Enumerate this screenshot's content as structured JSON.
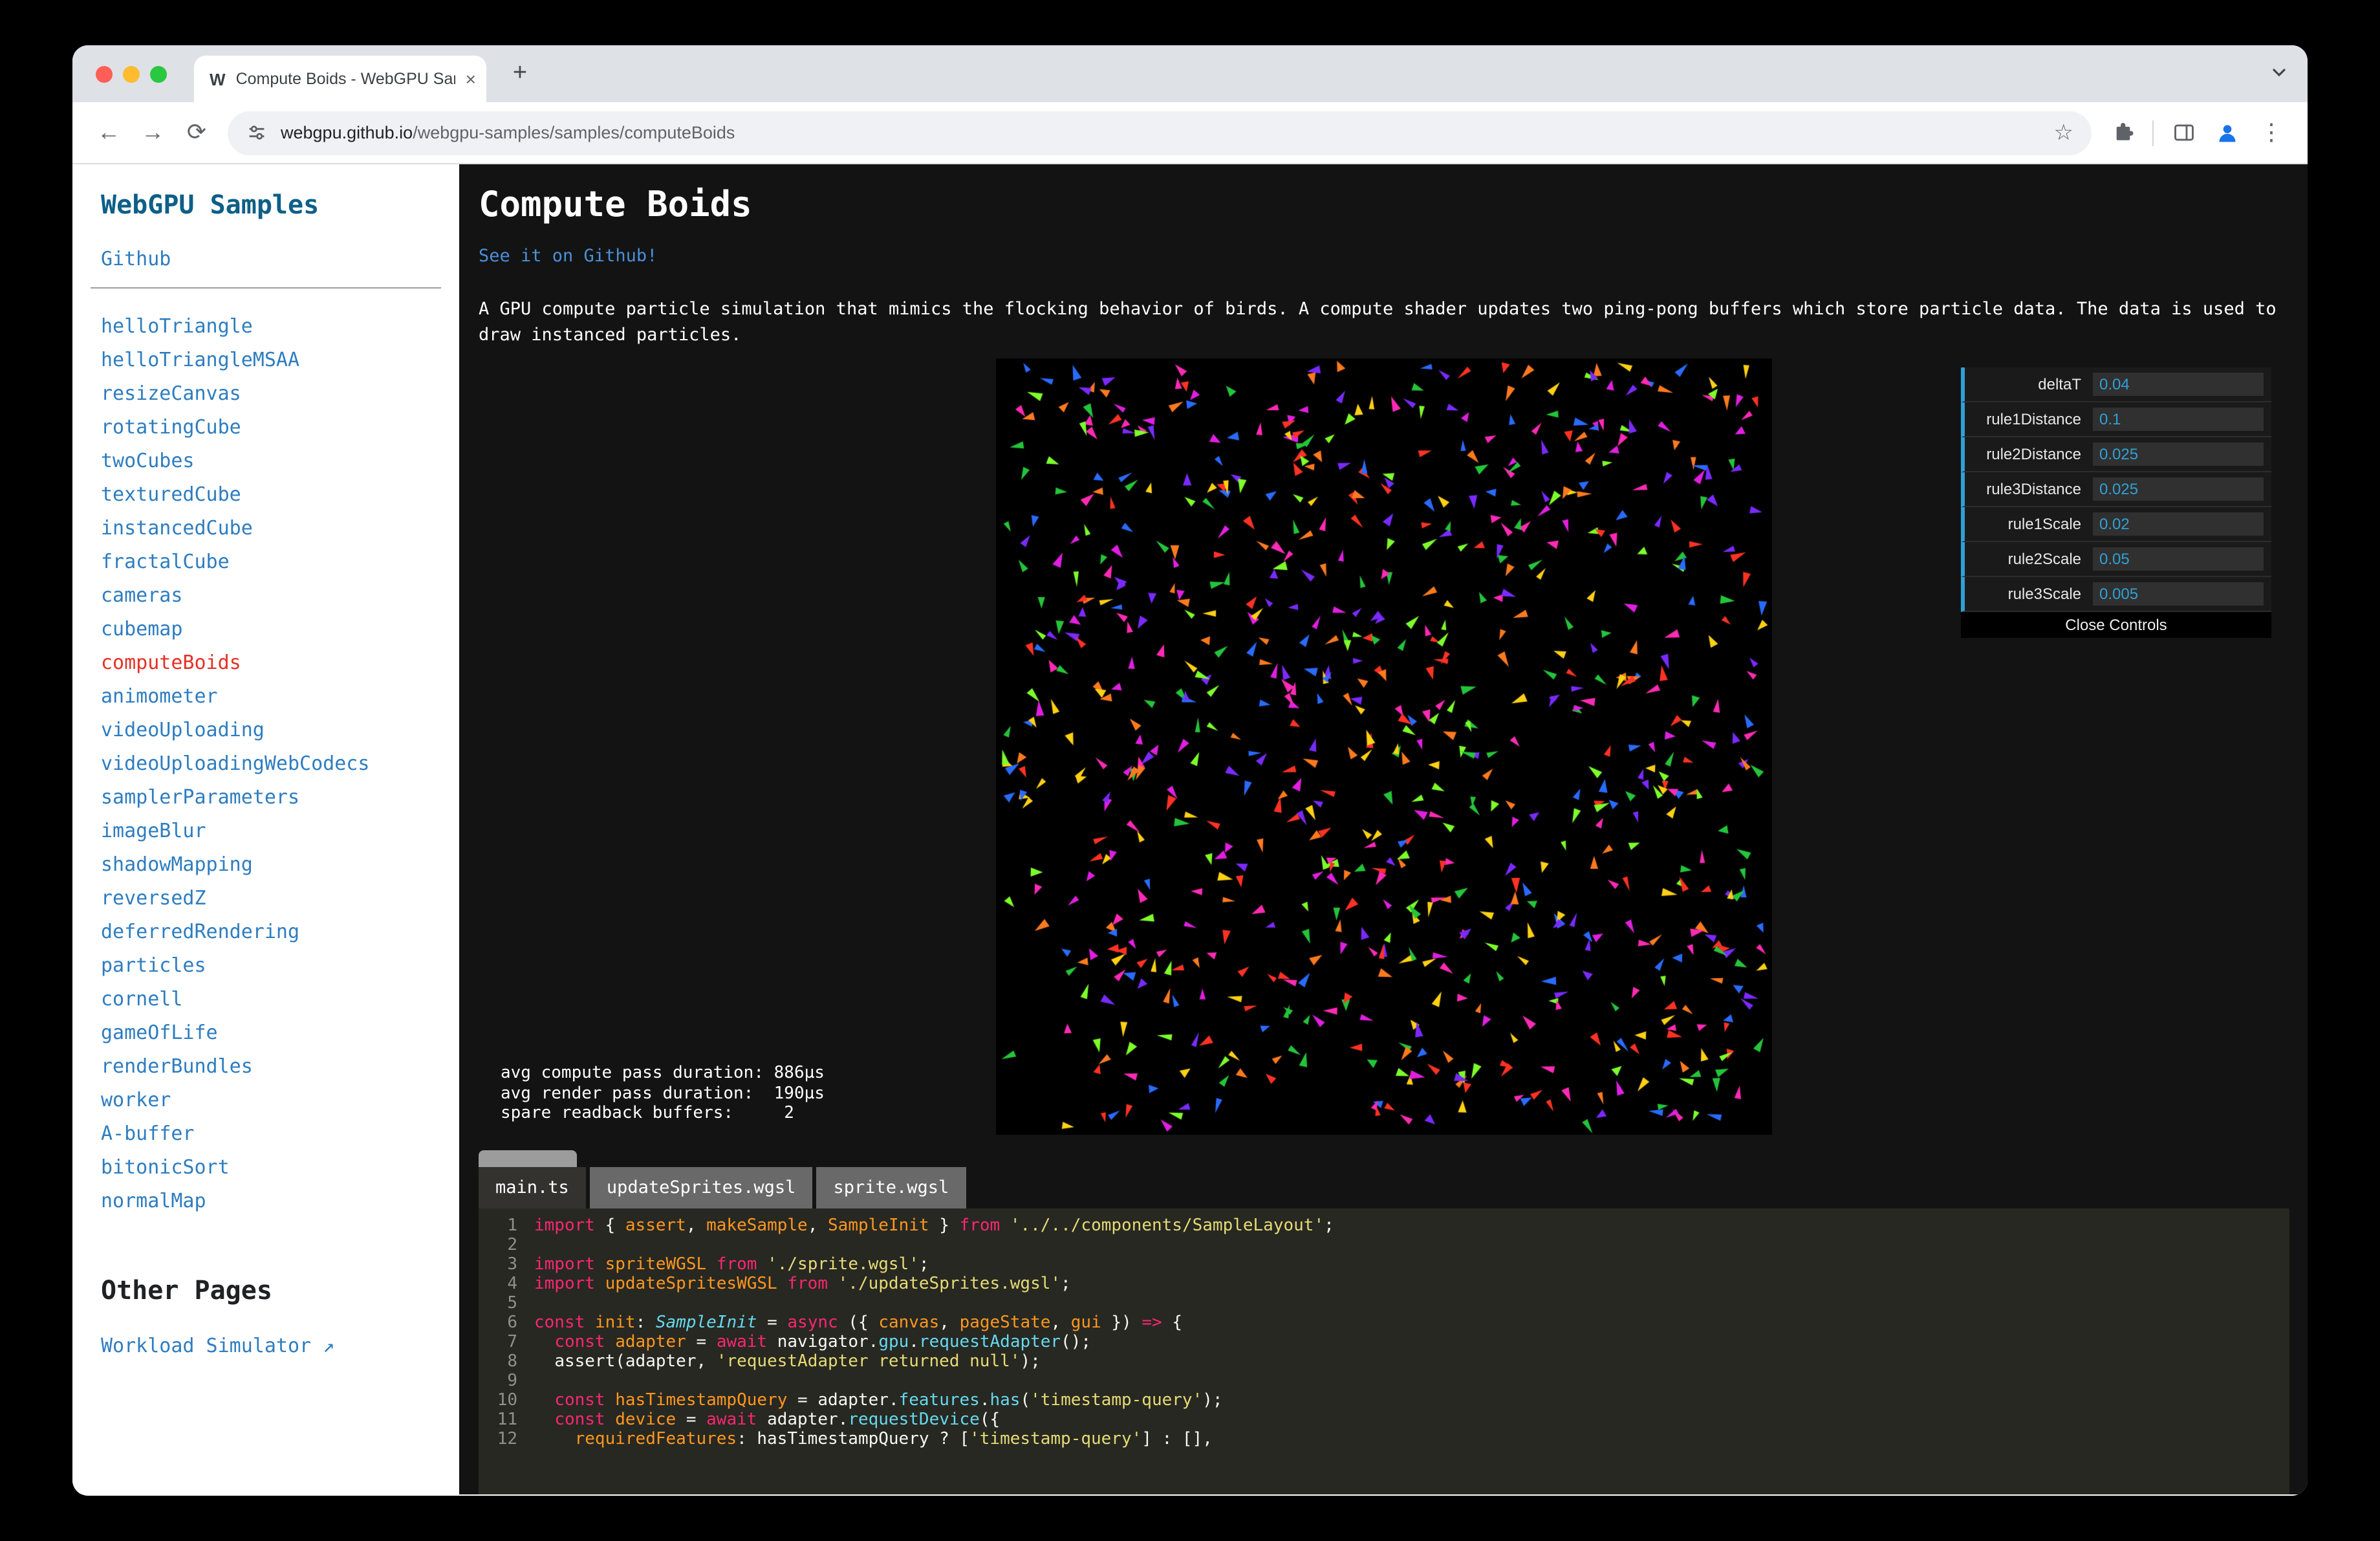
{
  "browser": {
    "tab_title": "Compute Boids - WebGPU Samples",
    "url_domain": "webgpu.github.io",
    "url_path": "/webgpu-samples/samples/computeBoids"
  },
  "icons": {
    "favicon": "W",
    "tab_close": "×",
    "new_tab": "+",
    "back": "←",
    "forward": "→",
    "reload": "⟳",
    "star": "☆",
    "menu": "⋮"
  },
  "sidebar": {
    "title": "WebGPU Samples",
    "github": "Github",
    "samples": [
      "helloTriangle",
      "helloTriangleMSAA",
      "resizeCanvas",
      "rotatingCube",
      "twoCubes",
      "texturedCube",
      "instancedCube",
      "fractalCube",
      "cameras",
      "cubemap",
      "computeBoids",
      "animometer",
      "videoUploading",
      "videoUploadingWebCodecs",
      "samplerParameters",
      "imageBlur",
      "shadowMapping",
      "reversedZ",
      "deferredRendering",
      "particles",
      "cornell",
      "gameOfLife",
      "renderBundles",
      "worker",
      "A-buffer",
      "bitonicSort",
      "normalMap"
    ],
    "active": "computeBoids",
    "other_pages": "Other Pages",
    "workload": "Workload Simulator ↗"
  },
  "main": {
    "title": "Compute Boids",
    "github_link": "See it on Github!",
    "description": "A GPU compute particle simulation that mimics the flocking behavior of birds. A compute shader updates two ping-pong buffers which store particle data. The data is used to draw instanced particles.",
    "stats": [
      "avg compute pass duration: 886µs",
      "avg render pass duration:  190µs",
      "spare readback buffers:     2"
    ]
  },
  "gui": {
    "rows": [
      {
        "label": "deltaT",
        "value": "0.04"
      },
      {
        "label": "rule1Distance",
        "value": "0.1"
      },
      {
        "label": "rule2Distance",
        "value": "0.025"
      },
      {
        "label": "rule3Distance",
        "value": "0.025"
      },
      {
        "label": "rule1Scale",
        "value": "0.02"
      },
      {
        "label": "rule2Scale",
        "value": "0.05"
      },
      {
        "label": "rule3Scale",
        "value": "0.005"
      }
    ],
    "close": "Close Controls",
    "accent": "#2fa1d6"
  },
  "colors": {
    "sidebar_link": "#2e7dc0",
    "active_sample": "#e53126",
    "page_link": "#4a90d9",
    "gui_accent": "#2fa1d6"
  },
  "code": {
    "tabs": [
      {
        "label": "main.ts",
        "active": true
      },
      {
        "label": "updateSprites.wgsl",
        "active": false
      },
      {
        "label": "sprite.wgsl",
        "active": false
      }
    ],
    "lines": [
      [
        [
          "k",
          "import"
        ],
        [
          "p",
          " { "
        ],
        [
          "d",
          "assert"
        ],
        [
          "p",
          ", "
        ],
        [
          "d",
          "makeSample"
        ],
        [
          "p",
          ", "
        ],
        [
          "d",
          "SampleInit"
        ],
        [
          "p",
          " } "
        ],
        [
          "k",
          "from"
        ],
        [
          "p",
          " "
        ],
        [
          "s",
          "'../../components/SampleLayout'"
        ],
        [
          "p",
          ";"
        ]
      ],
      [],
      [
        [
          "k",
          "import"
        ],
        [
          "p",
          " "
        ],
        [
          "d",
          "spriteWGSL"
        ],
        [
          "p",
          " "
        ],
        [
          "k",
          "from"
        ],
        [
          "p",
          " "
        ],
        [
          "s",
          "'./sprite.wgsl'"
        ],
        [
          "p",
          ";"
        ]
      ],
      [
        [
          "k",
          "import"
        ],
        [
          "p",
          " "
        ],
        [
          "d",
          "updateSpritesWGSL"
        ],
        [
          "p",
          " "
        ],
        [
          "k",
          "from"
        ],
        [
          "p",
          " "
        ],
        [
          "s",
          "'./updateSprites.wgsl'"
        ],
        [
          "p",
          ";"
        ]
      ],
      [],
      [
        [
          "k",
          "const"
        ],
        [
          "p",
          " "
        ],
        [
          "d",
          "init"
        ],
        [
          "p",
          ": "
        ],
        [
          "t",
          "SampleInit"
        ],
        [
          "p",
          " = "
        ],
        [
          "k",
          "async"
        ],
        [
          "p",
          " ({ "
        ],
        [
          "d",
          "canvas"
        ],
        [
          "p",
          ", "
        ],
        [
          "d",
          "pageState"
        ],
        [
          "p",
          ", "
        ],
        [
          "d",
          "gui"
        ],
        [
          "p",
          " }) "
        ],
        [
          "k",
          "=>"
        ],
        [
          "p",
          " {"
        ]
      ],
      [
        [
          "p",
          "  "
        ],
        [
          "k",
          "const"
        ],
        [
          "p",
          " "
        ],
        [
          "d",
          "adapter"
        ],
        [
          "p",
          " = "
        ],
        [
          "k",
          "await"
        ],
        [
          "p",
          " "
        ],
        [
          "v",
          "navigator"
        ],
        [
          "p",
          "."
        ],
        [
          "f",
          "gpu"
        ],
        [
          "p",
          "."
        ],
        [
          "f",
          "requestAdapter"
        ],
        [
          "p",
          "();"
        ]
      ],
      [
        [
          "p",
          "  "
        ],
        [
          "v",
          "assert"
        ],
        [
          "p",
          "("
        ],
        [
          "v",
          "adapter"
        ],
        [
          "p",
          ", "
        ],
        [
          "s",
          "'requestAdapter returned null'"
        ],
        [
          "p",
          ");"
        ]
      ],
      [],
      [
        [
          "p",
          "  "
        ],
        [
          "k",
          "const"
        ],
        [
          "p",
          " "
        ],
        [
          "d",
          "hasTimestampQuery"
        ],
        [
          "p",
          " = "
        ],
        [
          "v",
          "adapter"
        ],
        [
          "p",
          "."
        ],
        [
          "f",
          "features"
        ],
        [
          "p",
          "."
        ],
        [
          "f",
          "has"
        ],
        [
          "p",
          "("
        ],
        [
          "s",
          "'timestamp-query'"
        ],
        [
          "p",
          ");"
        ]
      ],
      [
        [
          "p",
          "  "
        ],
        [
          "k",
          "const"
        ],
        [
          "p",
          " "
        ],
        [
          "d",
          "device"
        ],
        [
          "p",
          " = "
        ],
        [
          "k",
          "await"
        ],
        [
          "p",
          " "
        ],
        [
          "v",
          "adapter"
        ],
        [
          "p",
          "."
        ],
        [
          "f",
          "requestDevice"
        ],
        [
          "p",
          "({"
        ]
      ],
      [
        [
          "p",
          "    "
        ],
        [
          "d",
          "requiredFeatures"
        ],
        [
          "p",
          ": "
        ],
        [
          "v",
          "hasTimestampQuery"
        ],
        [
          "p",
          " ? ["
        ],
        [
          "s",
          "'timestamp-query'"
        ],
        [
          "p",
          "] : [],"
        ]
      ]
    ]
  },
  "boids": {
    "count": 800,
    "seed": 13,
    "palette": [
      "#ff3224",
      "#ff7a1e",
      "#ffd013",
      "#7dff2a",
      "#24c43a",
      "#2a6bff",
      "#7a2aff",
      "#ff2ab4",
      "#e01fe0"
    ]
  }
}
